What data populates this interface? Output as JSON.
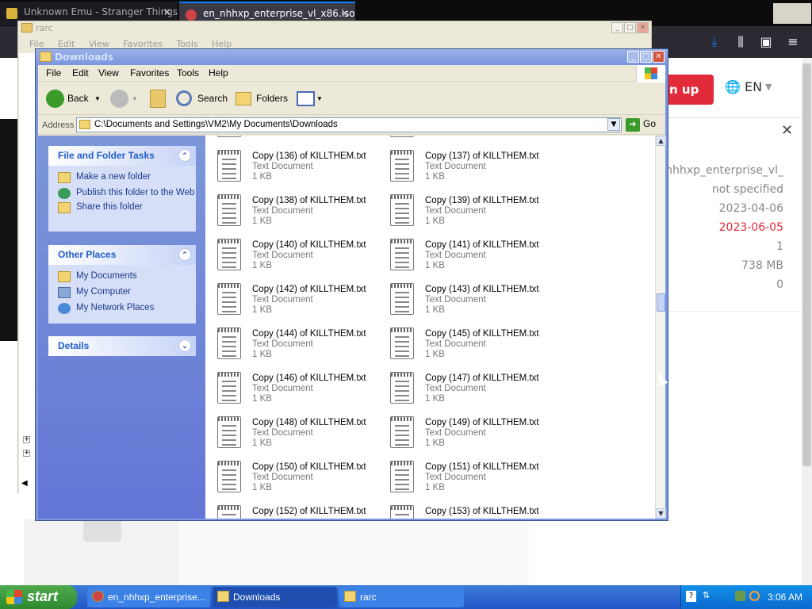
{
  "firefox": {
    "tabs": [
      {
        "title": "Unknown Emu - Stranger Things | Hulu"
      },
      {
        "title": "en_nhhxp_enterprise_vl_x86.iso |"
      }
    ],
    "page": {
      "signup_label": "n up",
      "lang_label": "EN",
      "details": [
        "en_nhhxp_enterprise_vl_",
        "not specified",
        "2023-04-06",
        "2023-06-05",
        "1",
        "738 MB",
        "0"
      ],
      "accent_color": "#e12b3a"
    }
  },
  "rarc": {
    "title": "rarc",
    "menu": [
      "File",
      "Edit",
      "View",
      "Favorites",
      "Tools",
      "Help"
    ]
  },
  "downloads": {
    "title": "Downloads",
    "menu": [
      "File",
      "Edit",
      "View",
      "Favorites",
      "Tools",
      "Help"
    ],
    "toolbar": {
      "back": "Back",
      "search": "Search",
      "folders": "Folders"
    },
    "address": {
      "label": "Address",
      "path": "C:\\Documents and Settings\\VM2\\My Documents\\Downloads",
      "go": "Go"
    },
    "tasks": {
      "file_folder_title": "File and Folder Tasks",
      "file_folder_items": [
        "Make a new folder",
        "Publish this folder to the Web",
        "Share this folder"
      ],
      "other_places_title": "Other Places",
      "other_places_items": [
        "My Documents",
        "My Computer",
        "My Network Places"
      ],
      "details_title": "Details"
    },
    "files": [
      {
        "name": "",
        "type": "",
        "size": "1 KB"
      },
      {
        "name": "",
        "type": "",
        "size": "1 KB"
      },
      {
        "name": "Copy (136) of KILLTHEM.txt",
        "type": "Text Document",
        "size": "1 KB"
      },
      {
        "name": "Copy (137) of KILLTHEM.txt",
        "type": "Text Document",
        "size": "1 KB"
      },
      {
        "name": "Copy (138) of KILLTHEM.txt",
        "type": "Text Document",
        "size": "1 KB"
      },
      {
        "name": "Copy (139) of KILLTHEM.txt",
        "type": "Text Document",
        "size": "1 KB"
      },
      {
        "name": "Copy (140) of KILLTHEM.txt",
        "type": "Text Document",
        "size": "1 KB"
      },
      {
        "name": "Copy (141) of KILLTHEM.txt",
        "type": "Text Document",
        "size": "1 KB"
      },
      {
        "name": "Copy (142) of KILLTHEM.txt",
        "type": "Text Document",
        "size": "1 KB"
      },
      {
        "name": "Copy (143) of KILLTHEM.txt",
        "type": "Text Document",
        "size": "1 KB"
      },
      {
        "name": "Copy (144) of KILLTHEM.txt",
        "type": "Text Document",
        "size": "1 KB"
      },
      {
        "name": "Copy (145) of KILLTHEM.txt",
        "type": "Text Document",
        "size": "1 KB"
      },
      {
        "name": "Copy (146) of KILLTHEM.txt",
        "type": "Text Document",
        "size": "1 KB"
      },
      {
        "name": "Copy (147) of KILLTHEM.txt",
        "type": "Text Document",
        "size": "1 KB"
      },
      {
        "name": "Copy (148) of KILLTHEM.txt",
        "type": "Text Document",
        "size": "1 KB"
      },
      {
        "name": "Copy (149) of KILLTHEM.txt",
        "type": "Text Document",
        "size": "1 KB"
      },
      {
        "name": "Copy (150) of KILLTHEM.txt",
        "type": "Text Document",
        "size": "1 KB"
      },
      {
        "name": "Copy (151) of KILLTHEM.txt",
        "type": "Text Document",
        "size": "1 KB"
      },
      {
        "name": "Copy (152) of KILLTHEM.txt",
        "type": "",
        "size": ""
      },
      {
        "name": "Copy (153) of KILLTHEM.txt",
        "type": "",
        "size": ""
      }
    ]
  },
  "taskbar": {
    "start_label": "start",
    "buttons": [
      "en_nhhxp_enterprise...",
      "Downloads",
      "rarc"
    ],
    "clock": "3:06 AM"
  }
}
